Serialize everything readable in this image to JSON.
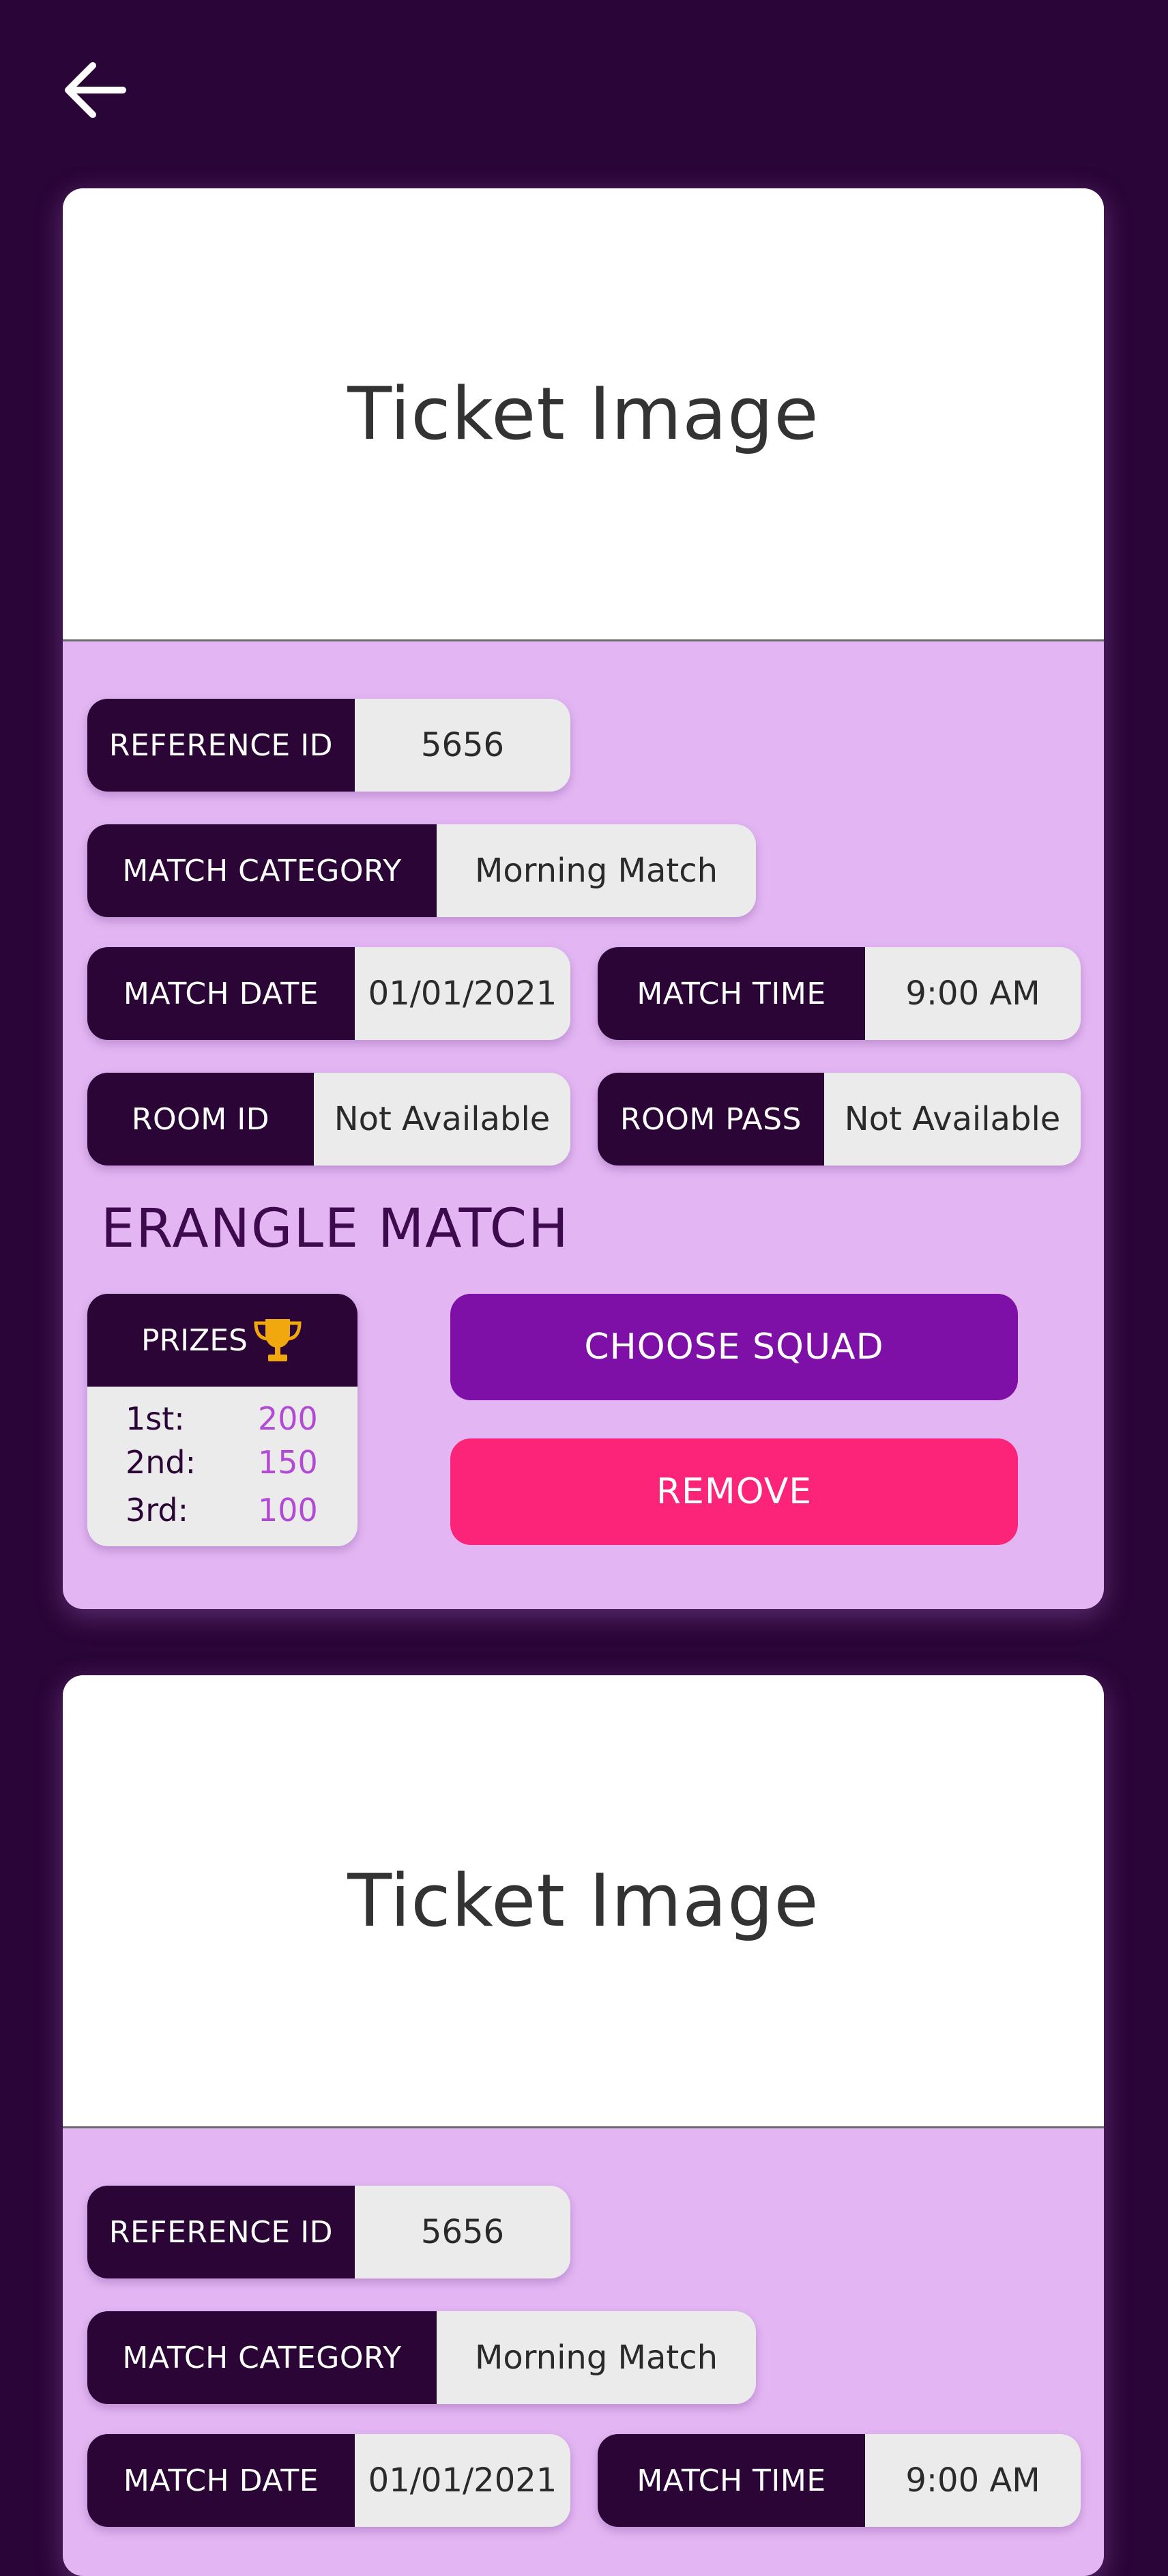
{
  "colors": {
    "background": "#2a0537",
    "card_body": "#e3b6f3",
    "label_bg": "#2b0536",
    "value_bg": "#ebebeb",
    "choose_squad": "#7e0fa7",
    "remove": "#fc2479",
    "prize_amount": "#b24ad6",
    "trophy": "#f0a80e"
  },
  "header": {
    "back_icon": "arrow-left-icon"
  },
  "cards": [
    {
      "image_label": "Ticket Image",
      "reference_id": {
        "label": "REFERENCE ID",
        "value": "5656"
      },
      "match_category": {
        "label": "MATCH CATEGORY",
        "value": "Morning Match"
      },
      "match_date": {
        "label": "MATCH DATE",
        "value": "01/01/2021"
      },
      "match_time": {
        "label": "MATCH TIME",
        "value": "9:00 AM"
      },
      "room_id": {
        "label": "ROOM ID",
        "value": "Not Available"
      },
      "room_pass": {
        "label": "ROOM PASS",
        "value": "Not Available"
      },
      "match_name": "ERANGLE MATCH",
      "prizes": {
        "label": "PRIZES",
        "icon": "trophy-icon",
        "rows": [
          {
            "place": "1st:",
            "amount": "200"
          },
          {
            "place": "2nd:",
            "amount": "150"
          },
          {
            "place": "3rd:",
            "amount": "100"
          }
        ]
      },
      "choose_squad_label": "CHOOSE SQUAD",
      "remove_label": "REMOVE"
    },
    {
      "image_label": "Ticket Image",
      "reference_id": {
        "label": "REFERENCE ID",
        "value": "5656"
      },
      "match_category": {
        "label": "MATCH CATEGORY",
        "value": "Morning Match"
      },
      "match_date": {
        "label": "MATCH DATE",
        "value": "01/01/2021"
      },
      "match_time": {
        "label": "MATCH TIME",
        "value": "9:00 AM"
      }
    }
  ]
}
